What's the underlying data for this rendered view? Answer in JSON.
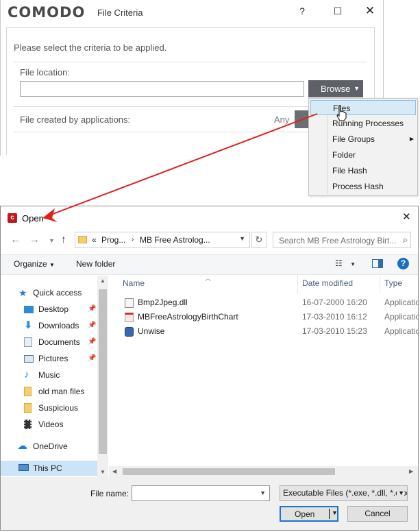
{
  "criteria_window": {
    "brand": "COMODO",
    "title": "File Criteria",
    "prompt": "Please select the criteria to be applied.",
    "file_location_label": "File location:",
    "file_location_value": "",
    "browse_label": "Browse",
    "created_by_label": "File created by applications:",
    "created_by_value": "Any"
  },
  "browse_menu": {
    "items": [
      {
        "label": "Files",
        "highlighted": true
      },
      {
        "label": "Running Processes"
      },
      {
        "label": "File Groups",
        "has_submenu": true
      },
      {
        "label": "Folder"
      },
      {
        "label": "File Hash"
      },
      {
        "label": "Process Hash"
      }
    ]
  },
  "open_dialog": {
    "title": "Open",
    "address": {
      "prefix": "«",
      "crumbs": [
        "Prog...",
        "MB Free Astrolog..."
      ]
    },
    "search_placeholder": "Search MB Free Astrology Birt...",
    "toolbar": {
      "organize": "Organize",
      "new_folder": "New folder"
    },
    "nav_items": [
      {
        "label": "Quick access",
        "icon": "star-icon",
        "pinned": false,
        "indent": 0
      },
      {
        "label": "Desktop",
        "icon": "desktop-icon",
        "pinned": true,
        "indent": 1
      },
      {
        "label": "Downloads",
        "icon": "download-icon",
        "pinned": true,
        "indent": 1
      },
      {
        "label": "Documents",
        "icon": "documents-icon",
        "pinned": true,
        "indent": 1
      },
      {
        "label": "Pictures",
        "icon": "pictures-icon",
        "pinned": true,
        "indent": 1
      },
      {
        "label": "Music",
        "icon": "music-icon",
        "pinned": false,
        "indent": 1
      },
      {
        "label": "old man files",
        "icon": "folder-icon",
        "pinned": false,
        "indent": 1
      },
      {
        "label": "Suspicious",
        "icon": "folder-icon",
        "pinned": false,
        "indent": 1
      },
      {
        "label": "Videos",
        "icon": "videos-icon",
        "pinned": false,
        "indent": 1
      },
      {
        "label": "OneDrive",
        "icon": "cloud-icon",
        "pinned": false,
        "indent": 0
      },
      {
        "label": "This PC",
        "icon": "computer-icon",
        "pinned": false,
        "indent": 0,
        "selected": true
      }
    ],
    "columns": {
      "name": "Name",
      "date": "Date modified",
      "type": "Type"
    },
    "files": [
      {
        "name": "Bmp2Jpeg.dll",
        "date": "16-07-2000 16:20",
        "type": "Application extension",
        "icon": "dll-icon"
      },
      {
        "name": "MBFreeAstrologyBirthChart",
        "date": "17-03-2010 16:12",
        "type": "Application",
        "icon": "app-icon"
      },
      {
        "name": "Unwise",
        "date": "17-03-2010 15:23",
        "type": "Application",
        "icon": "installer-icon"
      }
    ],
    "file_name_label": "File name:",
    "file_name_value": "",
    "file_type_value": "Executable Files (*.exe, *.dll, *.ocx)",
    "open_label": "Open",
    "cancel_label": "Cancel"
  },
  "colors": {
    "annotation_arrow": "#e0201b",
    "browse_button": "#5e6167",
    "selection": "#cce4f7",
    "menu_highlight": "#d9eaf7"
  }
}
